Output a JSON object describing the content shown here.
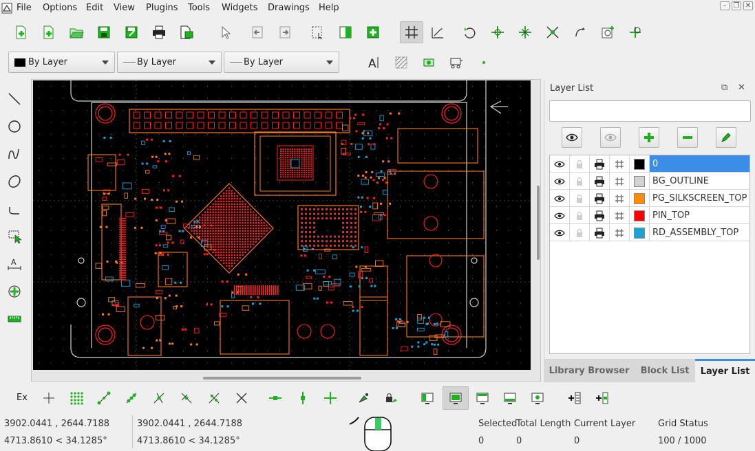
{
  "menu": {
    "items": [
      "File",
      "Options",
      "Edit",
      "View",
      "Plugins",
      "Tools",
      "Widgets",
      "Drawings",
      "Help"
    ]
  },
  "toolbar": {
    "icons": [
      "new-file-icon",
      "new-template-icon",
      "open-icon",
      "save-icon",
      "save-as-icon",
      "print-icon",
      "print-preview-icon",
      "select-pointer-icon",
      "back-icon",
      "forward-icon",
      "select-window-icon",
      "previous-view-icon",
      "add-view-icon",
      "grid-toggle-icon",
      "draft-mode-icon",
      "redraw-icon",
      "zoom-in-icon",
      "zoom-out-icon",
      "zoom-auto-icon",
      "zoom-previous-icon",
      "zoom-window-icon",
      "zoom-pan-icon"
    ],
    "active_icon": "grid-toggle-icon"
  },
  "pen_toolbar": {
    "color_label": "By Layer",
    "width_label": "By Layer",
    "linetype_label": "By Layer"
  },
  "left_tools": [
    "line-tool-icon",
    "circle-tool-icon",
    "curve-tool-icon",
    "ellipse-tool-icon",
    "polyline-tool-icon",
    "select-tool-icon",
    "dimension-tool-icon",
    "modify-tool-icon",
    "measure-tool-icon"
  ],
  "layer_panel": {
    "title": "Layer List",
    "filter_value": "",
    "layers": [
      {
        "name": "0",
        "color": "#000000",
        "selected": true
      },
      {
        "name": "BG_OUTLINE",
        "color": "#d3d3d3",
        "selected": false
      },
      {
        "name": "PG_SILKSCREEN_TOP",
        "color": "#ff8c00",
        "selected": false
      },
      {
        "name": "PIN_TOP",
        "color": "#ff0000",
        "selected": false
      },
      {
        "name": "RD_ASSEMBLY_TOP",
        "color": "#1aa3d6",
        "selected": false
      }
    ]
  },
  "panel_tabs": {
    "library": "Library Browser",
    "block": "Block List",
    "layer": "Layer List",
    "active": "Layer List"
  },
  "snap_bar": {
    "ex_label": "Ex"
  },
  "status": {
    "abs_coord": "3902.0441 , 2644.7188",
    "abs_polar": "4713.8610 < 34.1285°",
    "rel_coord": "3902.0441 , 2644.7188",
    "rel_polar": "4713.8610 < 34.1285°",
    "selected_label": "Selected",
    "selected_value": "0",
    "length_label": "Total Length",
    "length_value": "0",
    "layer_label": "Current Layer",
    "layer_value": "0",
    "grid_label": "Grid Status",
    "grid_value": "100 / 1000"
  },
  "colors": {
    "accent": "#3a8ee6",
    "pcb_red": "#ff2020",
    "pcb_orange": "#ff7a1a",
    "pcb_blue": "#1aa3d6",
    "outline": "#d3d3d3"
  }
}
